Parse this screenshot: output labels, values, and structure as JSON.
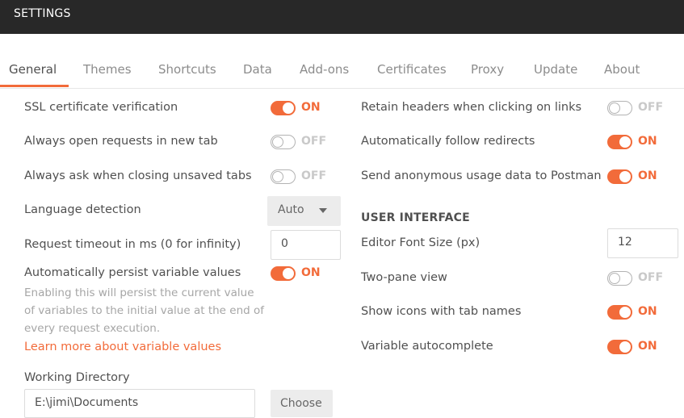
{
  "header": {
    "title": "SETTINGS"
  },
  "tabs": [
    {
      "label": "General",
      "active": true
    },
    {
      "label": "Themes"
    },
    {
      "label": "Shortcuts"
    },
    {
      "label": "Data"
    },
    {
      "label": "Add-ons"
    },
    {
      "label": "Certificates"
    },
    {
      "label": "Proxy"
    },
    {
      "label": "Update"
    },
    {
      "label": "About"
    }
  ],
  "general_left": {
    "ssl": {
      "label": "SSL certificate verification",
      "state": "ON"
    },
    "new_tab": {
      "label": "Always open requests in new tab",
      "state": "OFF"
    },
    "ask_close": {
      "label": "Always ask when closing unsaved tabs",
      "state": "OFF"
    },
    "language": {
      "label": "Language detection",
      "value": "Auto"
    },
    "timeout": {
      "label": "Request timeout in ms (0 for infinity)",
      "value": "0"
    },
    "persist": {
      "label": "Automatically persist variable values",
      "state": "ON",
      "helper": "Enabling this will persist the current value of variables to the initial value at the end of every request execution.",
      "link": "Learn more about variable values"
    },
    "working_dir": {
      "label": "Working Directory",
      "value": "E:\\jimi\\Documents",
      "button": "Choose"
    }
  },
  "general_right": {
    "retain_headers": {
      "label": "Retain headers when clicking on links",
      "state": "OFF"
    },
    "follow_redirects": {
      "label": "Automatically follow redirects",
      "state": "ON"
    },
    "usage_data": {
      "label": "Send anonymous usage data to Postman",
      "state": "ON"
    },
    "ui_heading": "USER INTERFACE",
    "font_size": {
      "label": "Editor Font Size (px)",
      "value": "12"
    },
    "two_pane": {
      "label": "Two-pane view",
      "state": "OFF"
    },
    "tab_icons": {
      "label": "Show icons with tab names",
      "state": "ON"
    },
    "autocomplete": {
      "label": "Variable autocomplete",
      "state": "ON"
    }
  },
  "colors": {
    "accent": "#f26b3a",
    "titlebar": "#282828"
  }
}
